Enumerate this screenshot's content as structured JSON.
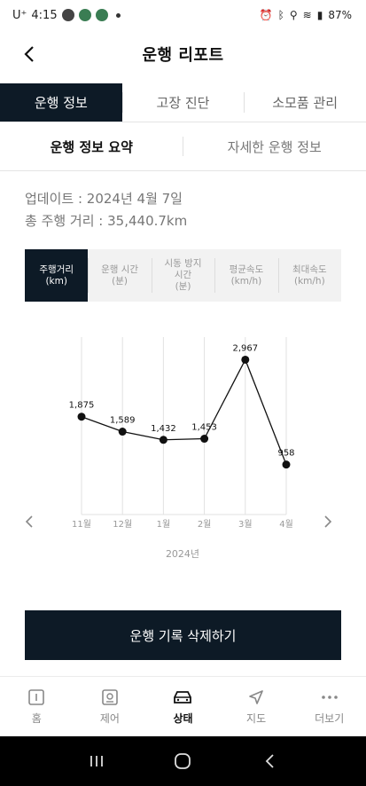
{
  "status_bar": {
    "carrier": "U⁺",
    "time": "4:15",
    "battery": "87%"
  },
  "header": {
    "title": "운행 리포트"
  },
  "main_tabs": [
    {
      "label": "운행 정보",
      "active": true
    },
    {
      "label": "고장 진단",
      "active": false
    },
    {
      "label": "소모품 관리",
      "active": false
    }
  ],
  "sub_tabs": [
    {
      "label": "운행 정보 요약",
      "active": true
    },
    {
      "label": "자세한 운행 정보",
      "active": false
    }
  ],
  "info": {
    "updated": "업데이트 : 2024년 4월 7일",
    "total_distance": "총 주행 거리 : 35,440.7km"
  },
  "metric_tabs": [
    {
      "label": "주행거리\n(km)",
      "active": true
    },
    {
      "label": "운행 시간\n(분)",
      "active": false
    },
    {
      "label": "시동 방지\n시간\n(분)",
      "active": false
    },
    {
      "label": "평균속도\n(km/h)",
      "active": false
    },
    {
      "label": "최대속도\n(km/h)",
      "active": false
    }
  ],
  "chart_data": {
    "type": "line",
    "categories": [
      "11월",
      "12월",
      "1월",
      "2월",
      "3월",
      "4월"
    ],
    "values": [
      1875,
      1589,
      1432,
      1453,
      2967,
      958
    ],
    "value_labels": [
      "1,875",
      "1,589",
      "1,432",
      "1,453",
      "2,967",
      "958"
    ],
    "xlabel": "2024년",
    "ylim": [
      0,
      3400
    ],
    "grid": "vertical",
    "line_color": "#111111"
  },
  "delete_button": {
    "label": "운행 기록 삭제하기"
  },
  "bottom_nav": [
    {
      "label": "홈",
      "icon": "home-icon",
      "active": false
    },
    {
      "label": "제어",
      "icon": "remote-control-icon",
      "active": false
    },
    {
      "label": "상태",
      "icon": "car-status-icon",
      "active": true
    },
    {
      "label": "지도",
      "icon": "navigation-arrow-icon",
      "active": false
    },
    {
      "label": "더보기",
      "icon": "more-dots-icon",
      "active": false
    }
  ]
}
